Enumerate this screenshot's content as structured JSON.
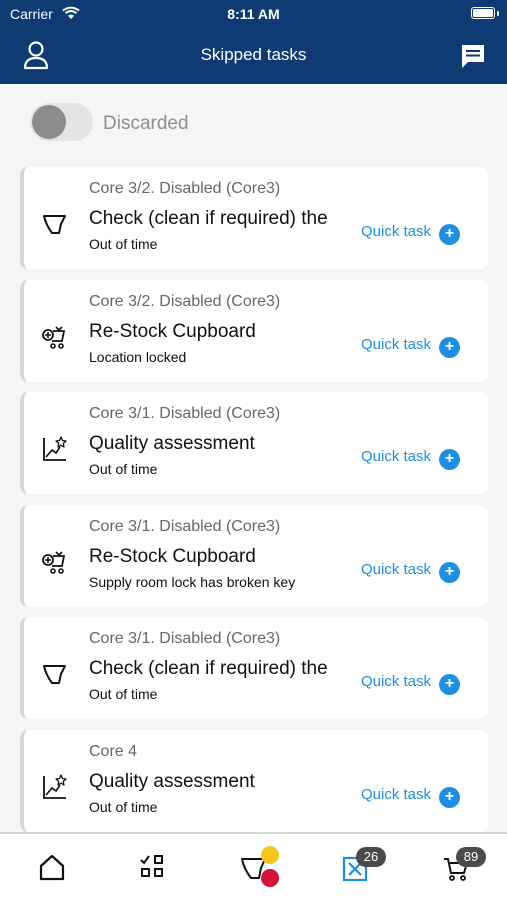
{
  "status_bar": {
    "carrier": "Carrier",
    "time": "8:11 AM"
  },
  "nav": {
    "title": "Skipped tasks"
  },
  "filter": {
    "label": "Discarded",
    "on": false
  },
  "tasks": [
    {
      "head": "Core 3/2. Disabled (Core3)",
      "title": "Check (clean if required) the",
      "sub": "Out of time",
      "action": "Quick task",
      "icon": "toilet-icon"
    },
    {
      "head": "Core 3/2. Disabled (Core3)",
      "title": "Re-Stock Cupboard",
      "sub": "Location locked",
      "action": "Quick task",
      "icon": "restock-cart-icon"
    },
    {
      "head": "Core 3/1. Disabled (Core3)",
      "title": "Quality assessment",
      "sub": "Out of time",
      "action": "Quick task",
      "icon": "quality-chart-icon"
    },
    {
      "head": "Core 3/1. Disabled (Core3)",
      "title": "Re-Stock Cupboard",
      "sub": "Supply room lock has broken key",
      "action": "Quick task",
      "icon": "restock-cart-icon"
    },
    {
      "head": "Core 3/1. Disabled (Core3)",
      "title": "Check (clean if required) the",
      "sub": "Out of time",
      "action": "Quick task",
      "icon": "toilet-icon"
    },
    {
      "head": "Core 4",
      "title": "Quality assessment",
      "sub": "Out of time",
      "action": "Quick task",
      "icon": "quality-chart-icon"
    }
  ],
  "tabbar": {
    "items": [
      {
        "icon": "home-icon"
      },
      {
        "icon": "checklist-grid-icon"
      },
      {
        "icon": "toilet-status-icon"
      },
      {
        "icon": "skipped-tasks-icon",
        "badge": "26",
        "active": true
      },
      {
        "icon": "cart-icon",
        "badge": "89"
      }
    ]
  },
  "colors": {
    "header": "#0f3a73",
    "accent": "#1d8fe3",
    "badge": "#4a4a4a",
    "dot_yellow": "#f5c51f",
    "dot_red": "#d5123b"
  }
}
